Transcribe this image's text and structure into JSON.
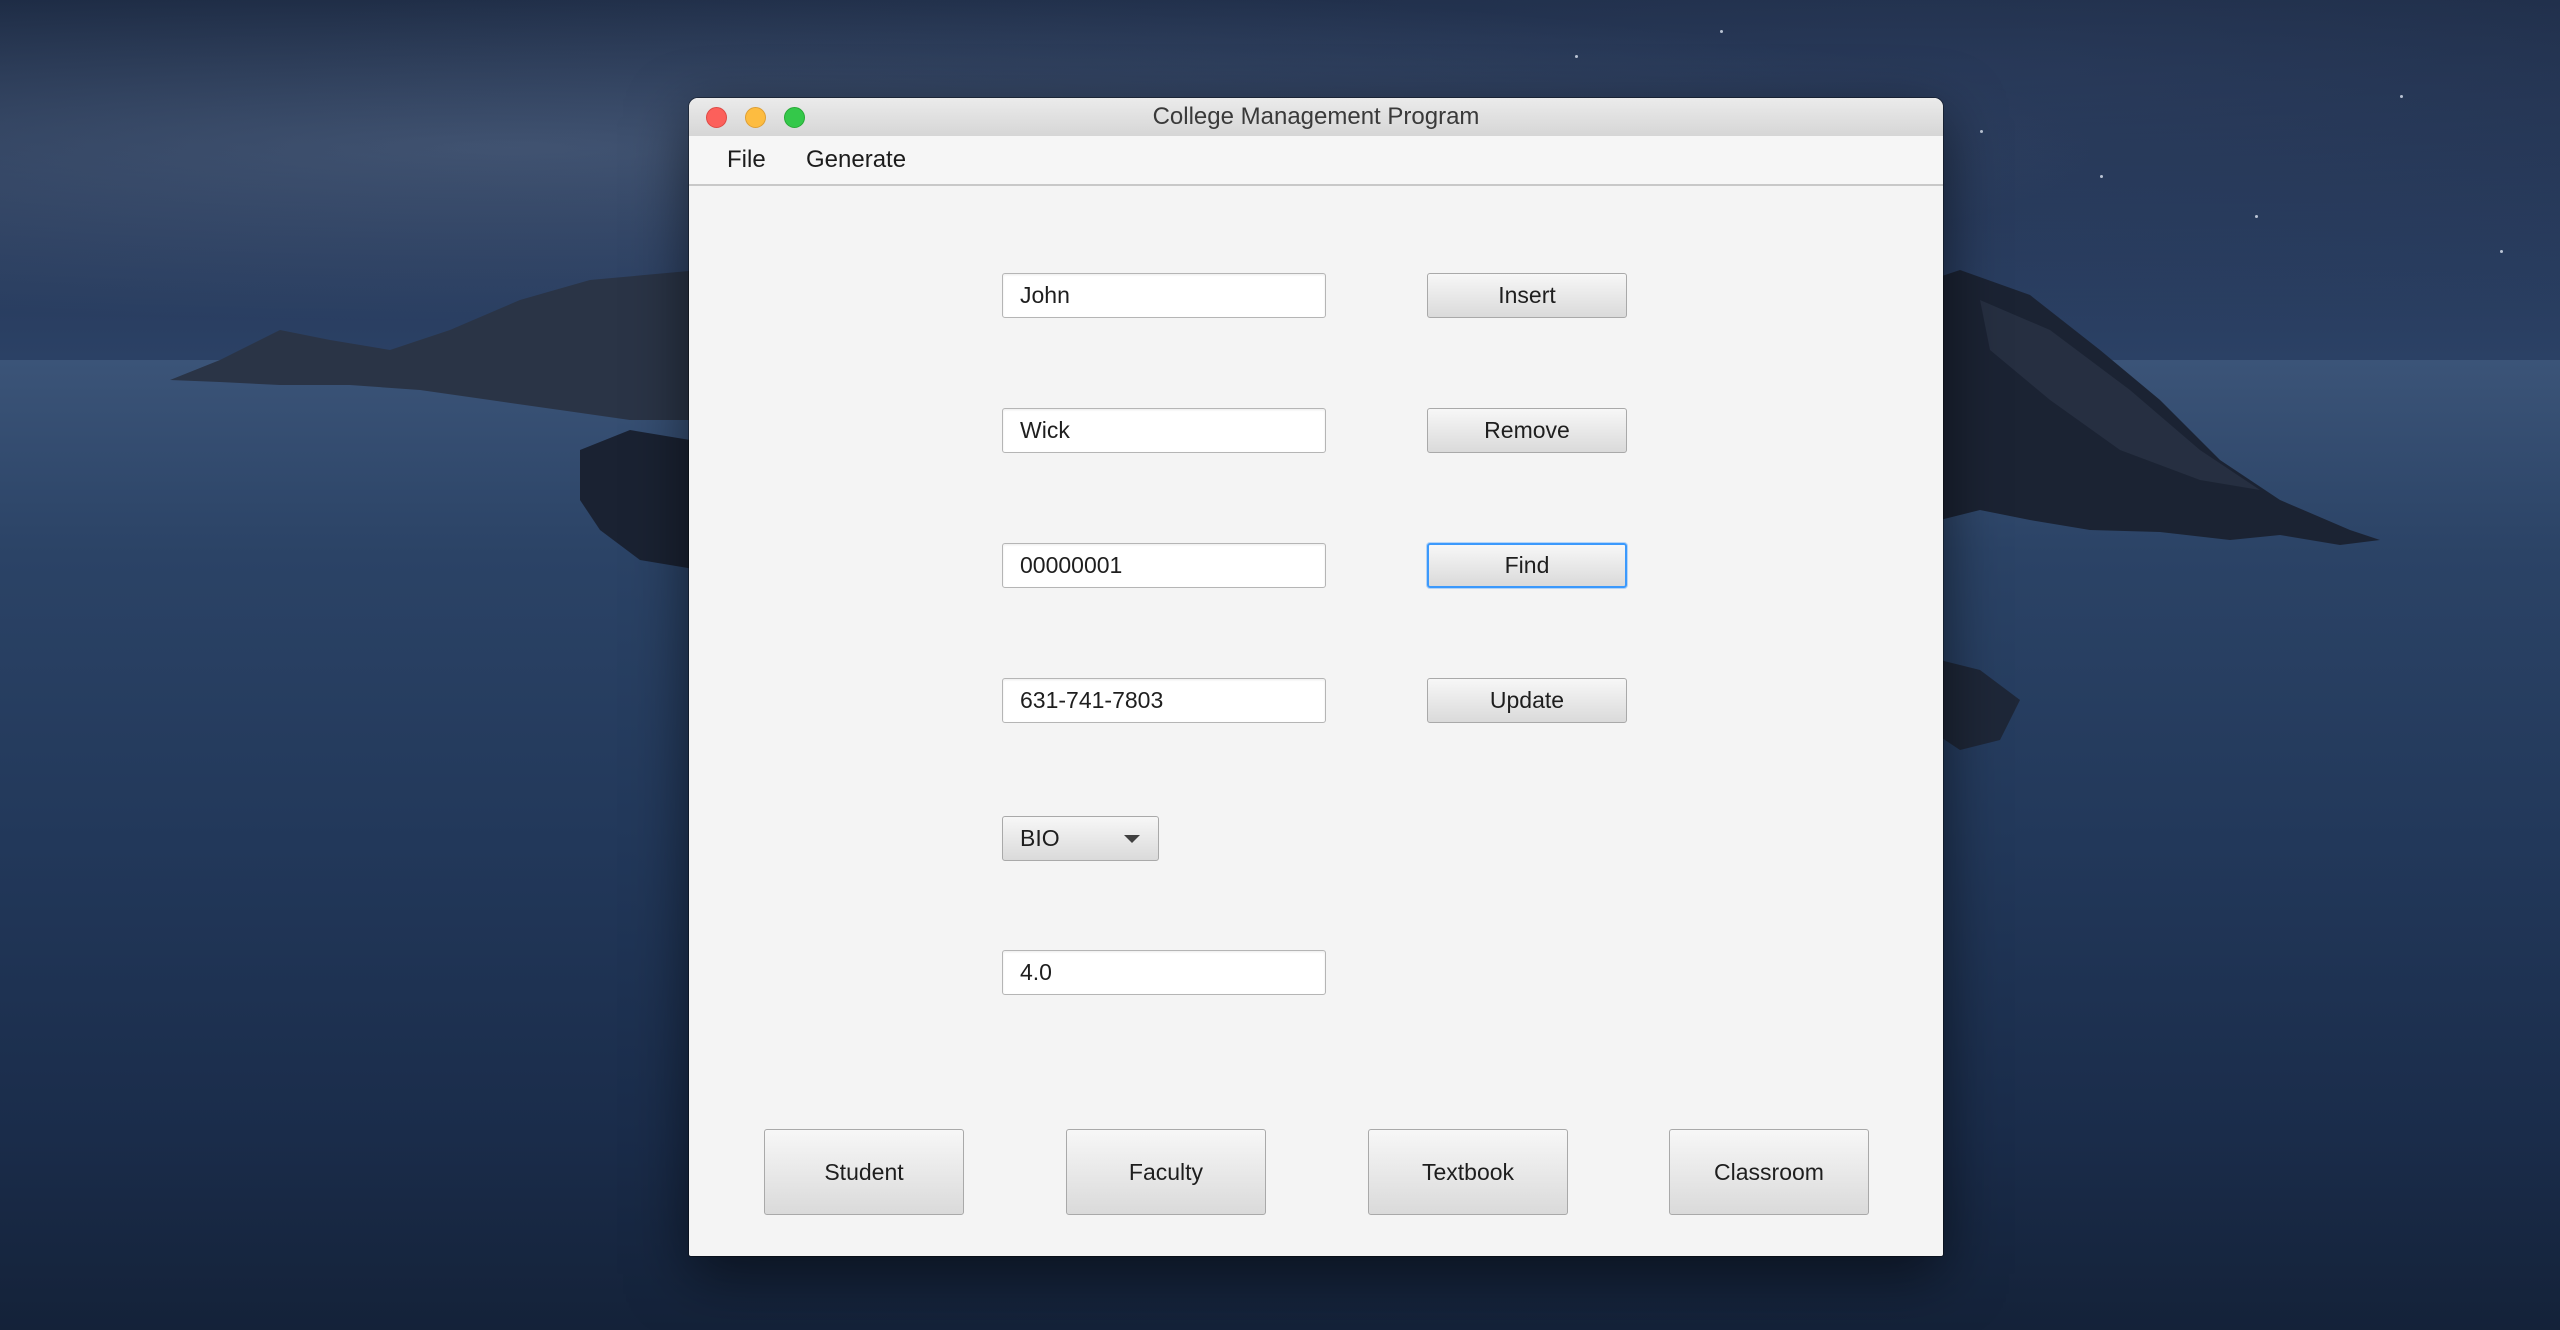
{
  "window": {
    "title": "College Management Program"
  },
  "menu": {
    "items": [
      "File",
      "Generate"
    ]
  },
  "form": {
    "first_name": "John",
    "last_name": "Wick",
    "id": "00000001",
    "phone": "631-741-7803",
    "department": "BIO",
    "gpa": "4.0"
  },
  "actions": {
    "insert": "Insert",
    "remove": "Remove",
    "find": "Find",
    "update": "Update"
  },
  "modes": [
    "Student",
    "Faculty",
    "Textbook",
    "Classroom"
  ],
  "icons": {
    "department_dropdown": "chevron-down-icon"
  },
  "colors": {
    "focus_ring": "#3b99fc",
    "close": "#fc605b",
    "minimize": "#fdbc40",
    "maximize": "#34c84a"
  }
}
